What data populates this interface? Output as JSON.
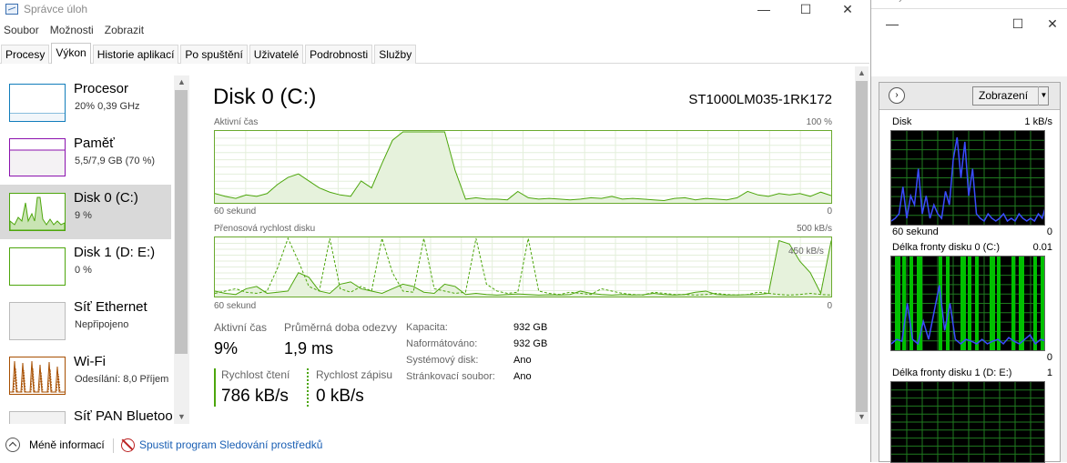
{
  "window": {
    "title": "Správce úloh",
    "minimize": "—",
    "maximize": "☐",
    "close": "✕"
  },
  "menu": [
    "Soubor",
    "Možnosti",
    "Zobrazit"
  ],
  "tabs": [
    "Procesy",
    "Výkon",
    "Historie aplikací",
    "Po spuštění",
    "Uživatelé",
    "Podrobnosti",
    "Služby"
  ],
  "active_tab": "Výkon",
  "sidebar": {
    "items": [
      {
        "name": "Procesor",
        "sub": "20% 0,39 GHz",
        "color": "#117dbb"
      },
      {
        "name": "Paměť",
        "sub": "5,5/7,9 GB (70 %)",
        "color": "#8b12ae"
      },
      {
        "name": "Disk 0 (C:)",
        "sub": "9 %",
        "color": "#4da60c"
      },
      {
        "name": "Disk 1 (D: E:)",
        "sub": "0 %",
        "color": "#4da60c"
      },
      {
        "name": "Síť Ethernet",
        "sub": "Nepřipojeno",
        "color": "#a74f01"
      },
      {
        "name": "Wi-Fi",
        "sub": "Odesílání: 8,0 Příjem",
        "color": "#a74f01"
      },
      {
        "name": "Síť PAN Bluetoo",
        "sub": "",
        "color": "#a74f01"
      }
    ]
  },
  "main": {
    "title": "Disk 0 (C:)",
    "model": "ST1000LM035-1RK172",
    "graph1": {
      "label": "Aktivní čas",
      "max": "100 %",
      "time": "60 sekund",
      "min": "0"
    },
    "graph2": {
      "label": "Přenosová rychlost disku",
      "max": "500 kB/s",
      "inner": "450 kB/s",
      "time": "60 sekund",
      "min": "0"
    },
    "stats": {
      "active_label": "Aktivní čas",
      "active_value": "9%",
      "resp_label": "Průměrná doba odezvy",
      "resp_value": "1,9 ms",
      "read_label": "Rychlost čtení",
      "read_value": "786 kB/s",
      "write_label": "Rychlost zápisu",
      "write_value": "0 kB/s"
    },
    "properties": [
      {
        "label": "Kapacita:",
        "value": "932 GB"
      },
      {
        "label": "Naformátováno:",
        "value": "932 GB"
      },
      {
        "label": "Systémový disk:",
        "value": "Ano"
      },
      {
        "label": "Stránkovací soubor:",
        "value": "Ano"
      }
    ]
  },
  "footer": {
    "less": "Méně informací",
    "resmon": "Spustit program Sledování prostředků"
  },
  "resmon": {
    "view_button": "Zobrazení",
    "disk_label": "Disk",
    "disk_max": "1 kB/s",
    "disk_time": "60 sekund",
    "disk_min": "0",
    "queue0_label": "Délka fronty disku 0 (C:)",
    "queue0_max": "0.01",
    "queue0_min": "0",
    "queue1_label": "Délka fronty disku 1 (D: E:)",
    "queue1_max": "1"
  },
  "chart_data": [
    {
      "type": "area",
      "title": "Aktivní čas",
      "ylim": [
        0,
        100
      ],
      "values": [
        12,
        8,
        5,
        10,
        8,
        12,
        25,
        35,
        40,
        30,
        20,
        14,
        10,
        8,
        30,
        20,
        55,
        88,
        100,
        100,
        100,
        100,
        100,
        45,
        4,
        6,
        4,
        4,
        3,
        15,
        6,
        4,
        5,
        4,
        3,
        4,
        6,
        5,
        8,
        4,
        5,
        4,
        3,
        2,
        5,
        6,
        3,
        5,
        4,
        3,
        6,
        15,
        10,
        8,
        12,
        10,
        12,
        8,
        14,
        9
      ]
    },
    {
      "type": "area",
      "title": "Přenosová rychlost disku",
      "ylim": [
        0,
        500
      ],
      "series": [
        {
          "name": "Rychlost čtení",
          "values": [
            40,
            20,
            10,
            60,
            80,
            20,
            30,
            40,
            200,
            160,
            40,
            20,
            100,
            120,
            60,
            40,
            20,
            60,
            100,
            80,
            30,
            20,
            100,
            80,
            10,
            20,
            10,
            5,
            10,
            15,
            10,
            5,
            8,
            6,
            10,
            40,
            20,
            10,
            5,
            10,
            6,
            8,
            20,
            10,
            5,
            10,
            30,
            40,
            10,
            5,
            6,
            8,
            10,
            20,
            480,
            450,
            300,
            200,
            20,
            480
          ]
        },
        {
          "name": "Rychlost zápisu",
          "values": [
            20,
            40,
            60,
            30,
            20,
            40,
            240,
            500,
            300,
            80,
            40,
            500,
            60,
            30,
            80,
            40,
            500,
            200,
            40,
            30,
            500,
            60,
            40,
            20,
            30,
            500,
            100,
            40,
            20,
            30,
            500,
            40,
            20,
            10,
            30,
            20,
            10,
            60,
            40,
            20,
            10,
            5,
            30,
            20,
            10,
            10,
            5,
            10,
            20,
            10,
            5,
            10,
            30,
            20,
            10,
            5,
            10,
            20,
            10,
            5
          ]
        }
      ]
    }
  ]
}
